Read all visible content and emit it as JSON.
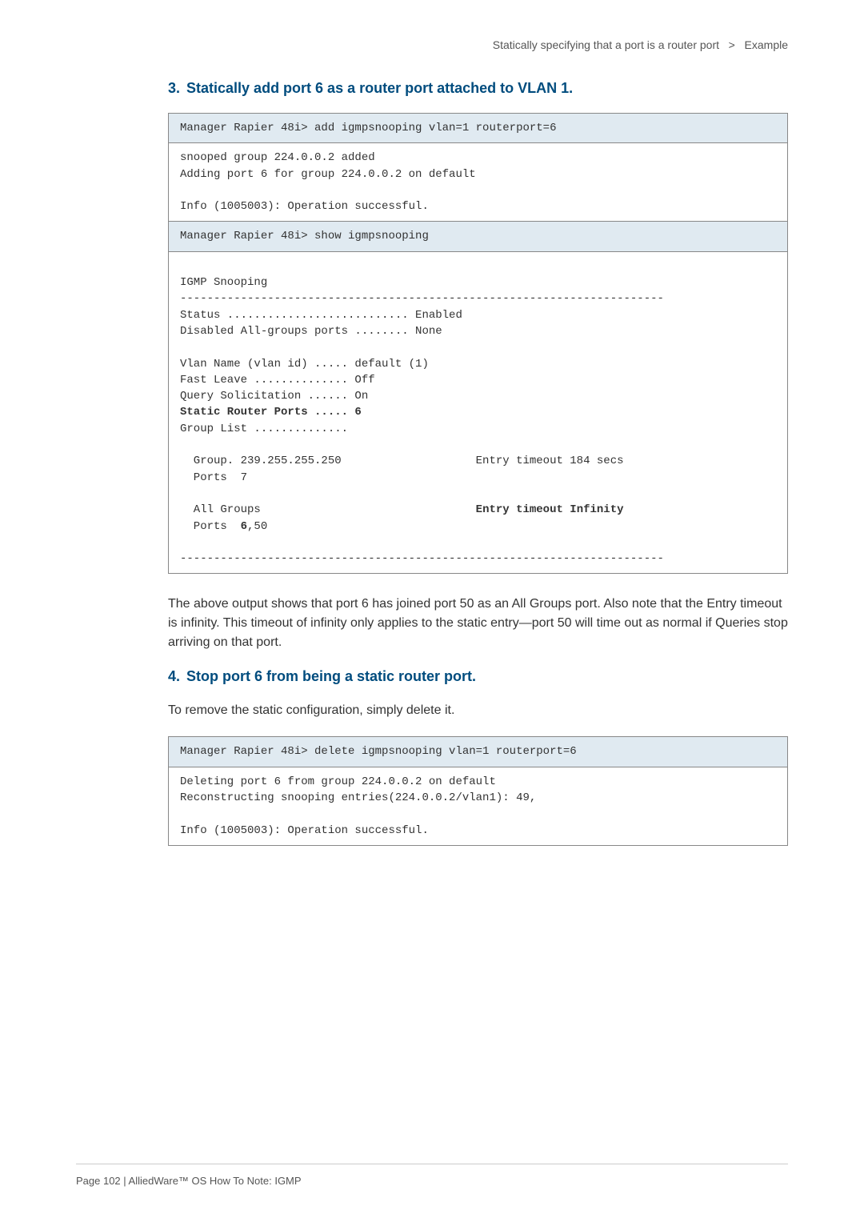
{
  "breadcrumb": {
    "section": "Statically specifying that a port is a router port",
    "separator": ">",
    "subsection": "Example"
  },
  "step3": {
    "num": "3.",
    "title": "Statically add port 6 as a router port attached to VLAN 1."
  },
  "block1": {
    "cmd": "Manager Rapier 48i> add igmpsnooping vlan=1 routerport=6",
    "line1": "snooped group 224.0.0.2 added",
    "line2": "Adding port 6 for group 224.0.0.2 on default",
    "line3": "Info (1005003): Operation successful.",
    "cmd2": "Manager Rapier 48i> show igmpsnooping",
    "out_title": "IGMP Snooping",
    "rule": "------------------------------------------------------------------------",
    "status": "Status ........................... Enabled",
    "disabled": "Disabled All-groups ports ........ None",
    "vlan": "Vlan Name (vlan id) ..... default (1)",
    "fastleave": "Fast Leave .............. Off",
    "query": "Query Solicitation ...... On",
    "staticports_label": "Static Router Ports ..... 6",
    "grouplist": "Group List ..............",
    "group_entry": "  Group. 239.255.255.250                    Entry timeout 184 secs",
    "ports_entry": "  Ports  7",
    "allgroups_label": "  All Groups                                ",
    "allgroups_value": "Entry timeout Infinity",
    "ports2_prefix": "  Ports  ",
    "ports2_bold": "6",
    "ports2_suffix": ",50",
    "rule2": "------------------------------------------------------------------------"
  },
  "para1": "The above output shows that port 6 has joined port 50 as an All Groups port. Also note that the Entry timeout is infinity.  This timeout of infinity only applies to the static entry—port 50 will time out as normal if Queries stop arriving on that port.",
  "step4": {
    "num": "4.",
    "title": "Stop port 6 from being a static router port."
  },
  "para2": "To remove the static configuration, simply delete it.",
  "block2": {
    "cmd": "Manager Rapier 48i> delete igmpsnooping vlan=1 routerport=6",
    "line1": "Deleting port 6 from group 224.0.0.2 on default",
    "line2": "Reconstructing snooping entries(224.0.0.2/vlan1): 49,",
    "line3": "Info (1005003): Operation successful."
  },
  "footer": "Page 102 | AlliedWare™ OS How To Note: IGMP"
}
